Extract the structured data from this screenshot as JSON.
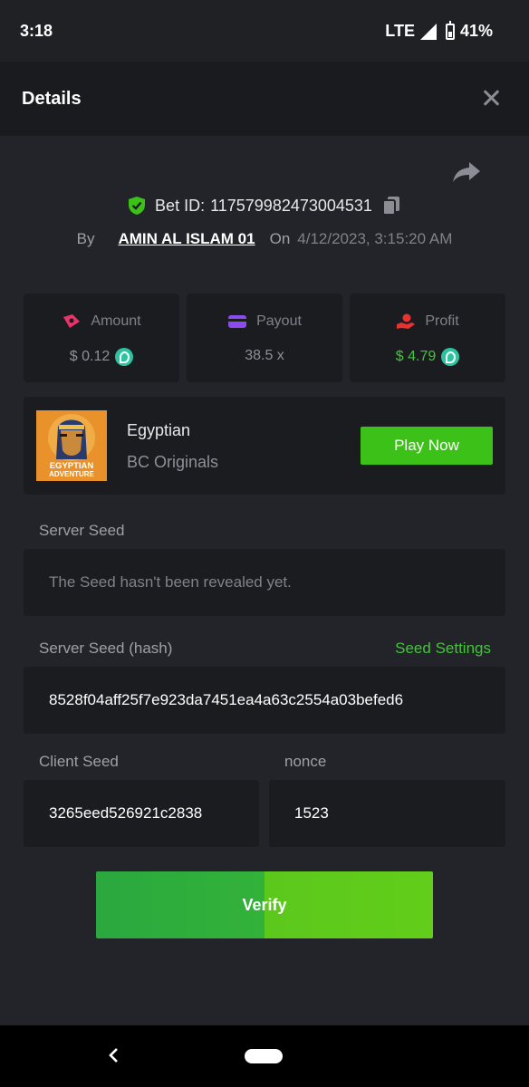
{
  "status_bar": {
    "time": "3:18",
    "network": "LTE",
    "battery": "41%"
  },
  "header": {
    "title": "Details"
  },
  "bet": {
    "id_label": "Bet ID:",
    "id_value": "117579982473004531",
    "by_label": "By",
    "user": "AMIN AL ISLAM 01",
    "on_label": "On",
    "date": "4/12/2023, 3:15:20 AM"
  },
  "stats": {
    "amount": {
      "label": "Amount",
      "value": "$ 0.12",
      "icon": "amount-icon",
      "color": "#e8336b"
    },
    "payout": {
      "label": "Payout",
      "value": "38.5 x",
      "icon": "wallet-icon",
      "color": "#8a4cf0"
    },
    "profit": {
      "label": "Profit",
      "value": "$ 4.79",
      "icon": "profit-hand-icon",
      "color": "#e83232"
    }
  },
  "game": {
    "thumb_title": "EGYPTIAN ADVENTURE",
    "name": "Egyptian",
    "provider": "BC Originals",
    "play_label": "Play Now"
  },
  "server_seed": {
    "label": "Server Seed",
    "value": "The Seed hasn't been revealed yet."
  },
  "server_seed_hash": {
    "label": "Server Seed (hash)",
    "link": "Seed Settings",
    "value": "8528f04aff25f7e923da7451ea4a63c2554a03befed6"
  },
  "client_seed": {
    "label": "Client Seed",
    "value": "3265eed526921c2838"
  },
  "nonce": {
    "label": "nonce",
    "value": "1523"
  },
  "verify_label": "Verify",
  "colors": {
    "accent_green": "#3bc117",
    "background": "#222429",
    "card": "#1b1c20"
  }
}
